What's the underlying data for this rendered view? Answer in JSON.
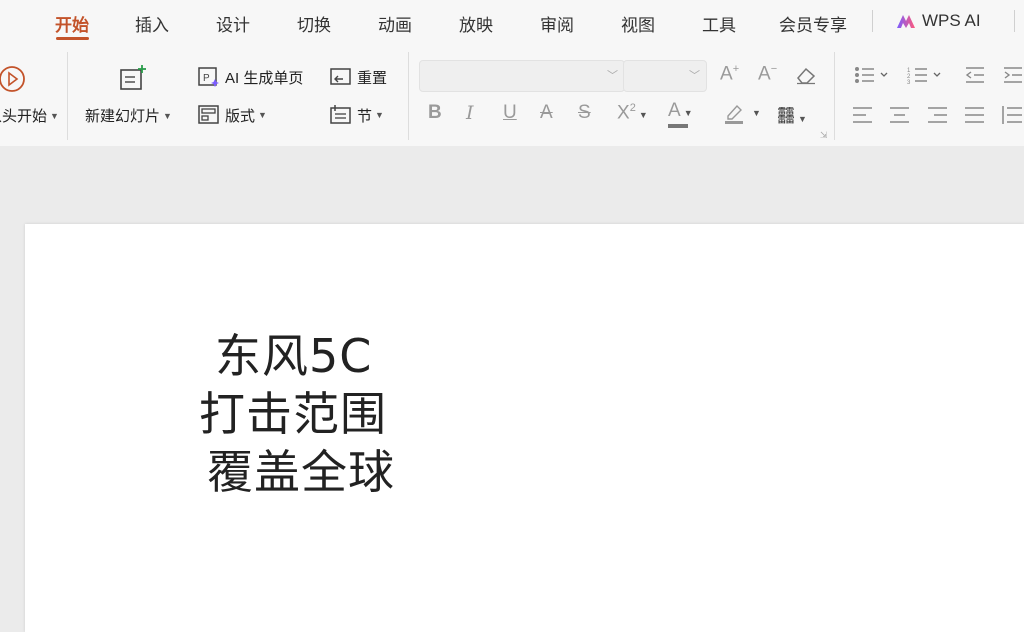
{
  "menu": {
    "tabs": [
      {
        "label": "开始",
        "active": true
      },
      {
        "label": "插入"
      },
      {
        "label": "设计"
      },
      {
        "label": "切换"
      },
      {
        "label": "动画"
      },
      {
        "label": "放映"
      },
      {
        "label": "审阅"
      },
      {
        "label": "视图"
      },
      {
        "label": "工具"
      },
      {
        "label": "会员专享"
      }
    ],
    "wps_ai": "WPS AI"
  },
  "ribbon": {
    "play_from_start": "从头开始",
    "new_slide": "新建幻灯片",
    "ai_generate_page": "AI 生成单页",
    "layout": "版式",
    "reset": "重置",
    "section": "节",
    "font_name": "",
    "font_size": ""
  },
  "slide": {
    "lines": [
      "东风5C",
      "打击范围",
      "覆盖全球"
    ]
  },
  "colors": {
    "accent": "#c3532a",
    "ai_gradient_start": "#7b5cff",
    "ai_gradient_end": "#ff5a7a"
  }
}
